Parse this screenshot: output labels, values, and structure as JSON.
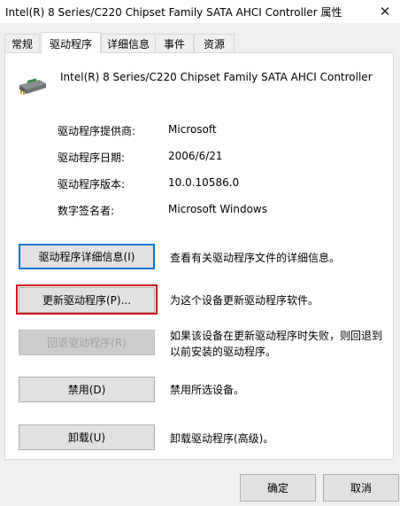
{
  "window": {
    "title": "Intel(R) 8 Series/C220 Chipset Family SATA AHCI Controller  属性",
    "close_icon": "close-icon"
  },
  "tabs": [
    {
      "label": "常规",
      "active": false
    },
    {
      "label": "驱动程序",
      "active": true
    },
    {
      "label": "详细信息",
      "active": false
    },
    {
      "label": "事件",
      "active": false
    },
    {
      "label": "资源",
      "active": false
    }
  ],
  "device": {
    "icon": "storage-controller-icon",
    "name": "Intel(R) 8 Series/C220 Chipset Family SATA AHCI Controller"
  },
  "driver_info": [
    {
      "label": "驱动程序提供商:",
      "value": "Microsoft"
    },
    {
      "label": "驱动程序日期:",
      "value": "2006/6/21"
    },
    {
      "label": "驱动程序版本:",
      "value": "10.0.10586.0"
    },
    {
      "label": "数字签名者:",
      "value": "Microsoft Windows"
    }
  ],
  "actions": [
    {
      "button": "驱动程序详细信息(I)",
      "description": "查看有关驱动程序文件的详细信息。",
      "enabled": true
    },
    {
      "button": "更新驱动程序(P)...",
      "description": "为这个设备更新驱动程序软件。",
      "enabled": true
    },
    {
      "button": "回退驱动程序(R)",
      "description_line1": "如果该设备在更新驱动程序时失败，则回退到",
      "description_line2": "以前安装的驱动程序。",
      "enabled": false
    },
    {
      "button": "禁用(D)",
      "description": "禁用所选设备。",
      "enabled": true
    },
    {
      "button": "卸载(U)",
      "description": "卸载驱动程序(高级)。",
      "enabled": true
    }
  ],
  "footer": {
    "ok_label": "确定",
    "cancel_label": "取消"
  },
  "colors": {
    "focus_border": "#0078d7",
    "highlight_box": "#d0121b"
  }
}
